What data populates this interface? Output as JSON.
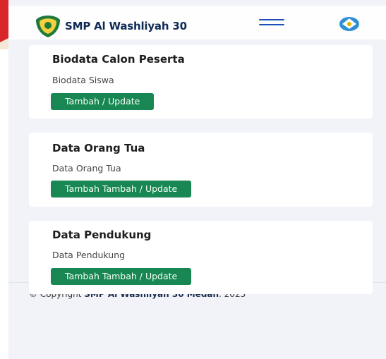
{
  "header": {
    "brand_name": "SMP Al Washliyah 30",
    "logo_icon": "school-logo-icon",
    "menu_icon": "hamburger-menu-icon",
    "emblem_icon": "tut-wuri-handayani-emblem-icon"
  },
  "cards": [
    {
      "title": "Biodata Calon Peserta",
      "text": "Biodata Siswa",
      "button": "Tambah / Update"
    },
    {
      "title": "Data Orang Tua",
      "text": "Data Orang Tua",
      "button": "Tambah Tambah / Update"
    },
    {
      "title": "Data Pendukung",
      "text": "Data Pendukung",
      "button": "Tambah Tambah / Update"
    }
  ],
  "footer": {
    "prefix": "© Copyright ",
    "org": "SMP Al Washliyah 30 Medan",
    "suffix": ". 2025"
  },
  "colors": {
    "button_green": "#198754",
    "brand_text": "#0f2a55",
    "menu_blue": "#1c4fb8",
    "page_bg": "#f1f3f8"
  }
}
